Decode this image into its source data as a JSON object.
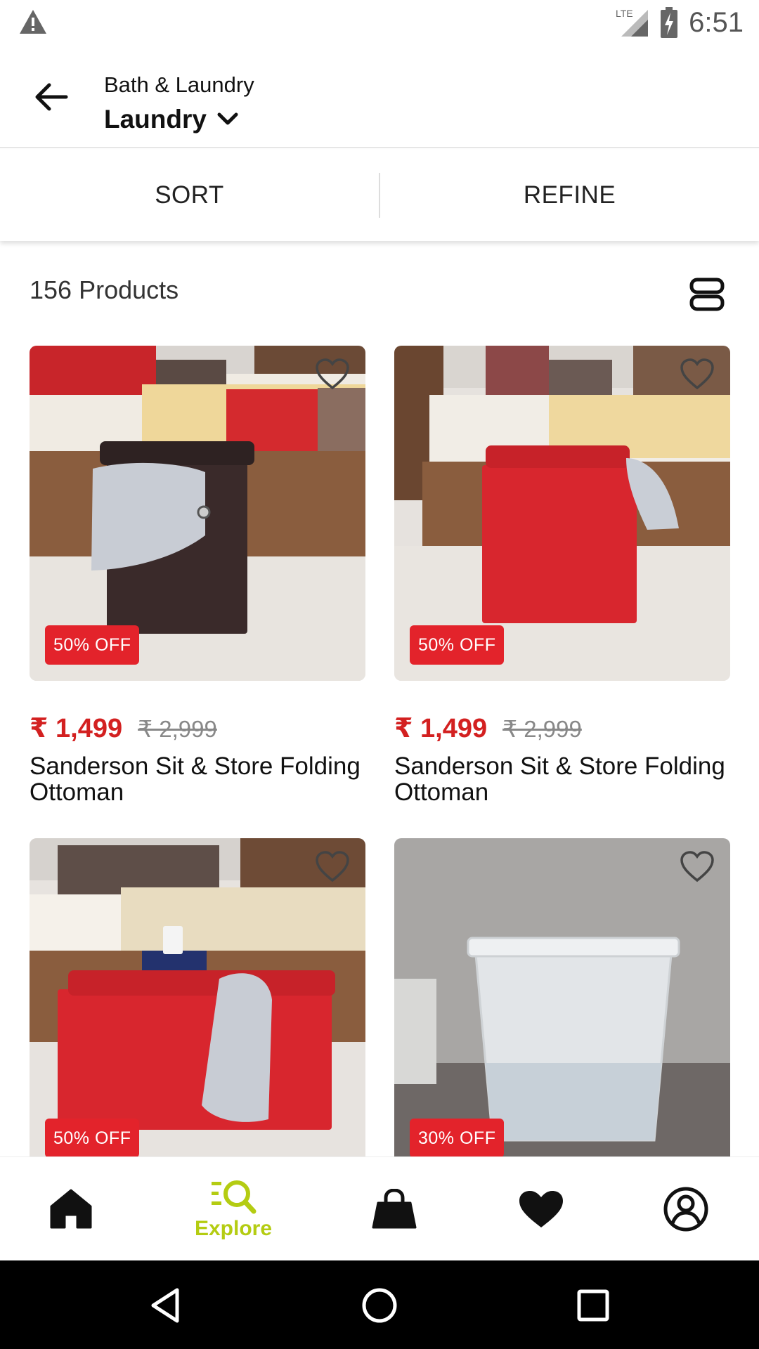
{
  "status_bar": {
    "time": "6:51",
    "network": "LTE",
    "icons": [
      "warning-icon",
      "signal-icon",
      "battery-charging-icon"
    ]
  },
  "header": {
    "breadcrumb": "Bath & Laundry",
    "category": "Laundry"
  },
  "actions": {
    "sort_label": "SORT",
    "refine_label": "REFINE"
  },
  "listing": {
    "count_label": "156 Products"
  },
  "products": [
    {
      "badge": "50% OFF",
      "price": "₹ 1,499",
      "mrp": "₹ 2,999",
      "name": "Sanderson Sit & Store Folding Ottoman"
    },
    {
      "badge": "50% OFF",
      "price": "₹ 1,499",
      "mrp": "₹ 2,999",
      "name": "Sanderson Sit & Store Folding Ottoman"
    },
    {
      "badge": "50% OFF"
    },
    {
      "badge": "30% OFF"
    }
  ],
  "bottom_nav": {
    "explore_label": "Explore",
    "active": "Explore",
    "accent_color": "#b4cc12"
  },
  "colors": {
    "sale_red": "#e3232b",
    "price_red": "#d32020"
  }
}
